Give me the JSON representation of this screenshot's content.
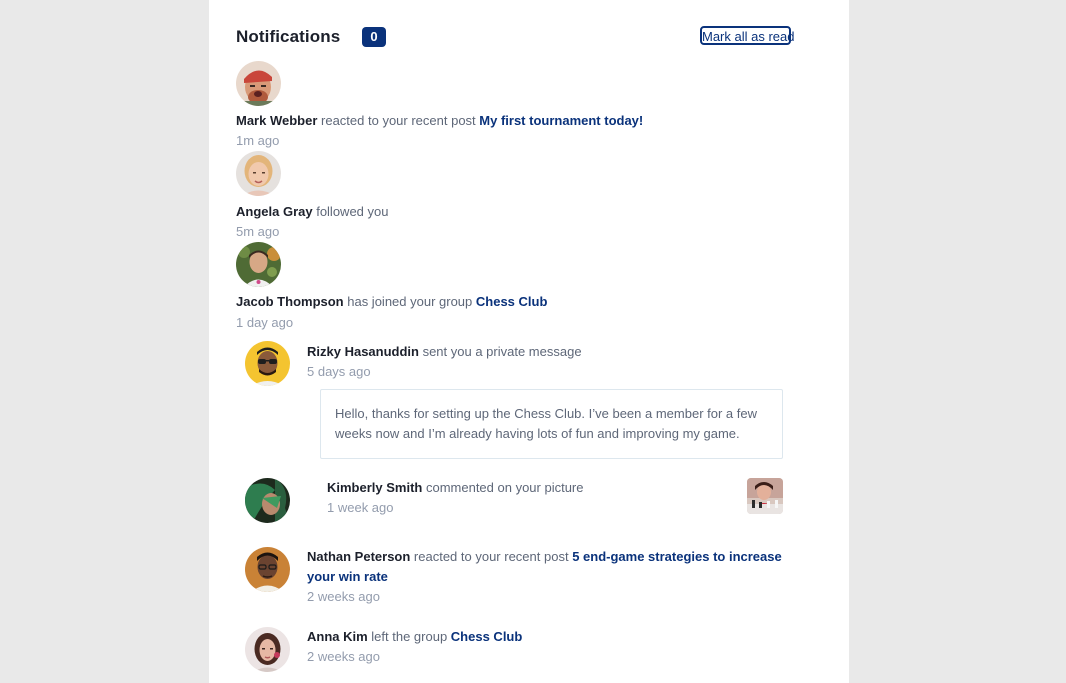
{
  "header": {
    "title": "Notifications",
    "unread_count": "0",
    "mark_all_label": "Mark all as read"
  },
  "notifications": [
    {
      "name": "Mark Webber",
      "action": " reacted to your recent post ",
      "target": "My first tournament today!",
      "time": "1m ago",
      "avatar_icon": "avatar-mark-webber"
    },
    {
      "name": "Angela Gray",
      "action": " followed you",
      "target": "",
      "time": "5m ago",
      "avatar_icon": "avatar-angela-gray"
    },
    {
      "name": "Jacob Thompson",
      "action": " has joined your group ",
      "target": "Chess Club",
      "time": "1 day ago",
      "avatar_icon": "avatar-jacob-thompson"
    },
    {
      "name": "Rizky Hasanuddin",
      "action": " sent you a private message",
      "target": "",
      "time": "5 days ago",
      "message": "Hello, thanks for setting up the Chess Club. I’ve been a member for a few weeks now and I’m already having lots of fun and improving my game.",
      "avatar_icon": "avatar-rizky-hasanuddin"
    },
    {
      "name": "Kimberly Smith",
      "action": " commented on your picture",
      "target": "",
      "time": "1 week ago",
      "avatar_icon": "avatar-kimberly-smith",
      "picture_icon": "chess-picture-thumbnail"
    },
    {
      "name": "Nathan Peterson",
      "action": " reacted to your recent post ",
      "target": "5 end-game strategies to increase your win rate",
      "time": "2 weeks ago",
      "avatar_icon": "avatar-nathan-peterson"
    },
    {
      "name": "Anna Kim",
      "action": " left the group ",
      "target": "Chess Club",
      "time": "2 weeks ago",
      "avatar_icon": "avatar-anna-kim"
    }
  ],
  "colors": {
    "page_background": "#e9e9e9",
    "card_background": "#ffffff",
    "primary_text": "#1c202b",
    "secondary_text": "#5e6778",
    "muted_text": "#939cad",
    "accent_blue": "#0a327b"
  }
}
